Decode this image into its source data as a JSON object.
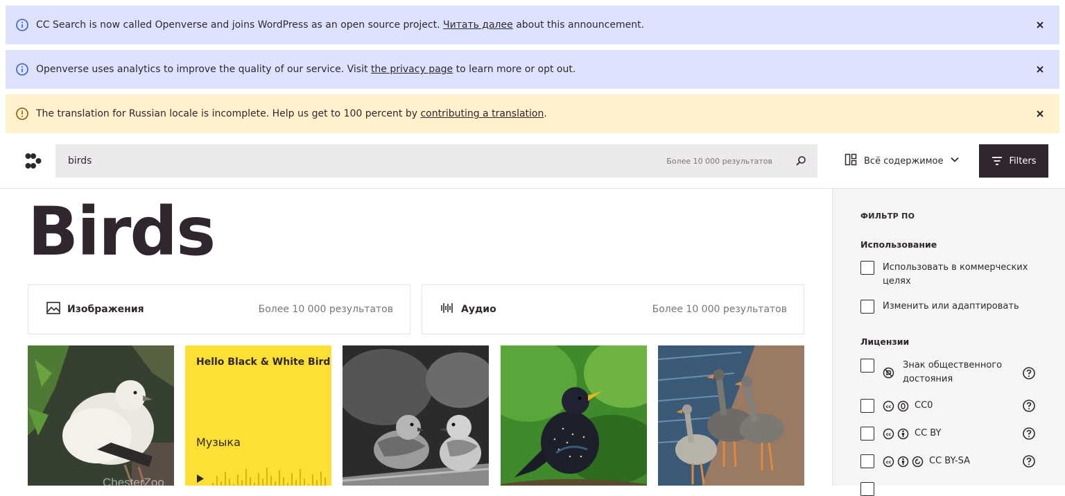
{
  "banners": [
    {
      "pre": "CC Search is now called Openverse and joins WordPress as an open source project. ",
      "link": "Читать далее",
      "post": " about this announcement."
    },
    {
      "pre": "Openverse uses analytics to improve the quality of our service. Visit ",
      "link": "the privacy page",
      "post": " to learn more or opt out."
    },
    {
      "pre": "The translation for Russian locale is incomplete. Help us get to 100 percent by ",
      "link": "contributing a translation",
      "post": "."
    }
  ],
  "search": {
    "value": "birds",
    "count": "Более 10 000 результатов"
  },
  "content_type": {
    "label": "Всё содержимое"
  },
  "filters_button": "Filters",
  "page_title": "Birds",
  "media_cards": [
    {
      "name": "Изображения",
      "count": "Более 10 000 результатов"
    },
    {
      "name": "Аудио",
      "count": "Более 10 000 результатов"
    }
  ],
  "audio_tile": {
    "title": "Hello Black & White Bird",
    "genre": "Музыка"
  },
  "image_watermark": "ChesterZoo",
  "sidebar": {
    "heading": "ФИЛЬТР ПО",
    "usage_title": "Использование",
    "usage": [
      "Использовать в коммерческих целях",
      "Изменить или адаптировать"
    ],
    "licenses_title": "Лицензии",
    "licenses": [
      "Знак общественного достояния",
      "CC0",
      "CC BY",
      "CC BY-SA"
    ]
  },
  "colors": {
    "info_banner": "#dde3fd",
    "warning_banner": "#fff1cc",
    "accent_dark": "#30272e",
    "audio_yellow": "#fde034"
  }
}
